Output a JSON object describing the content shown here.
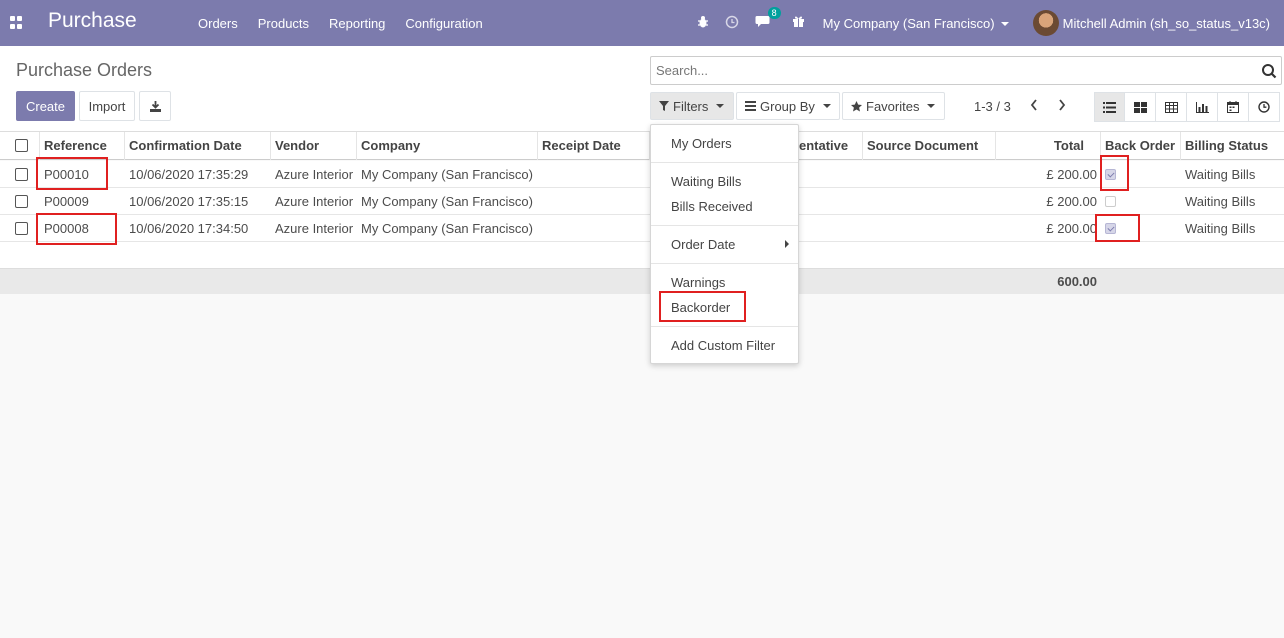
{
  "navbar": {
    "app_name": "Purchase",
    "menu": [
      "Orders",
      "Products",
      "Reporting",
      "Configuration"
    ],
    "messages_badge": "8",
    "company": "My Company (San Francisco)",
    "user": "Mitchell Admin (sh_so_status_v13c)"
  },
  "control": {
    "title": "Purchase Orders",
    "create_label": "Create",
    "import_label": "Import",
    "search_placeholder": "Search...",
    "filters_label": "Filters",
    "groupby_label": "Group By",
    "favorites_label": "Favorites",
    "pager": "1-3 / 3"
  },
  "table": {
    "headers": [
      "Reference",
      "Confirmation Date",
      "Vendor",
      "Company",
      "Receipt Date",
      "entative",
      "Source Document",
      "Total",
      "Back Order",
      "Billing Status"
    ],
    "rows": [
      {
        "reference": "P00010",
        "confirmation_date": "10/06/2020 17:35:29",
        "vendor": "Azure Interior",
        "company": "My Company (San Francisco)",
        "total": "£ 200.00",
        "back_order": true,
        "billing_status": "Waiting Bills"
      },
      {
        "reference": "P00009",
        "confirmation_date": "10/06/2020 17:35:15",
        "vendor": "Azure Interior",
        "company": "My Company (San Francisco)",
        "total": "£ 200.00",
        "back_order": false,
        "billing_status": "Waiting Bills"
      },
      {
        "reference": "P00008",
        "confirmation_date": "10/06/2020 17:34:50",
        "vendor": "Azure Interior",
        "company": "My Company (San Francisco)",
        "total": "£ 200.00",
        "back_order": true,
        "billing_status": "Waiting Bills"
      }
    ],
    "grand_total": "600.00"
  },
  "filters_menu": {
    "my_orders": "My Orders",
    "waiting_bills": "Waiting Bills",
    "bills_received": "Bills Received",
    "order_date": "Order Date",
    "warnings": "Warnings",
    "backorder": "Backorder",
    "add_custom": "Add Custom Filter"
  },
  "colors": {
    "brand": "#7c7bad",
    "highlight": "#e02020"
  }
}
